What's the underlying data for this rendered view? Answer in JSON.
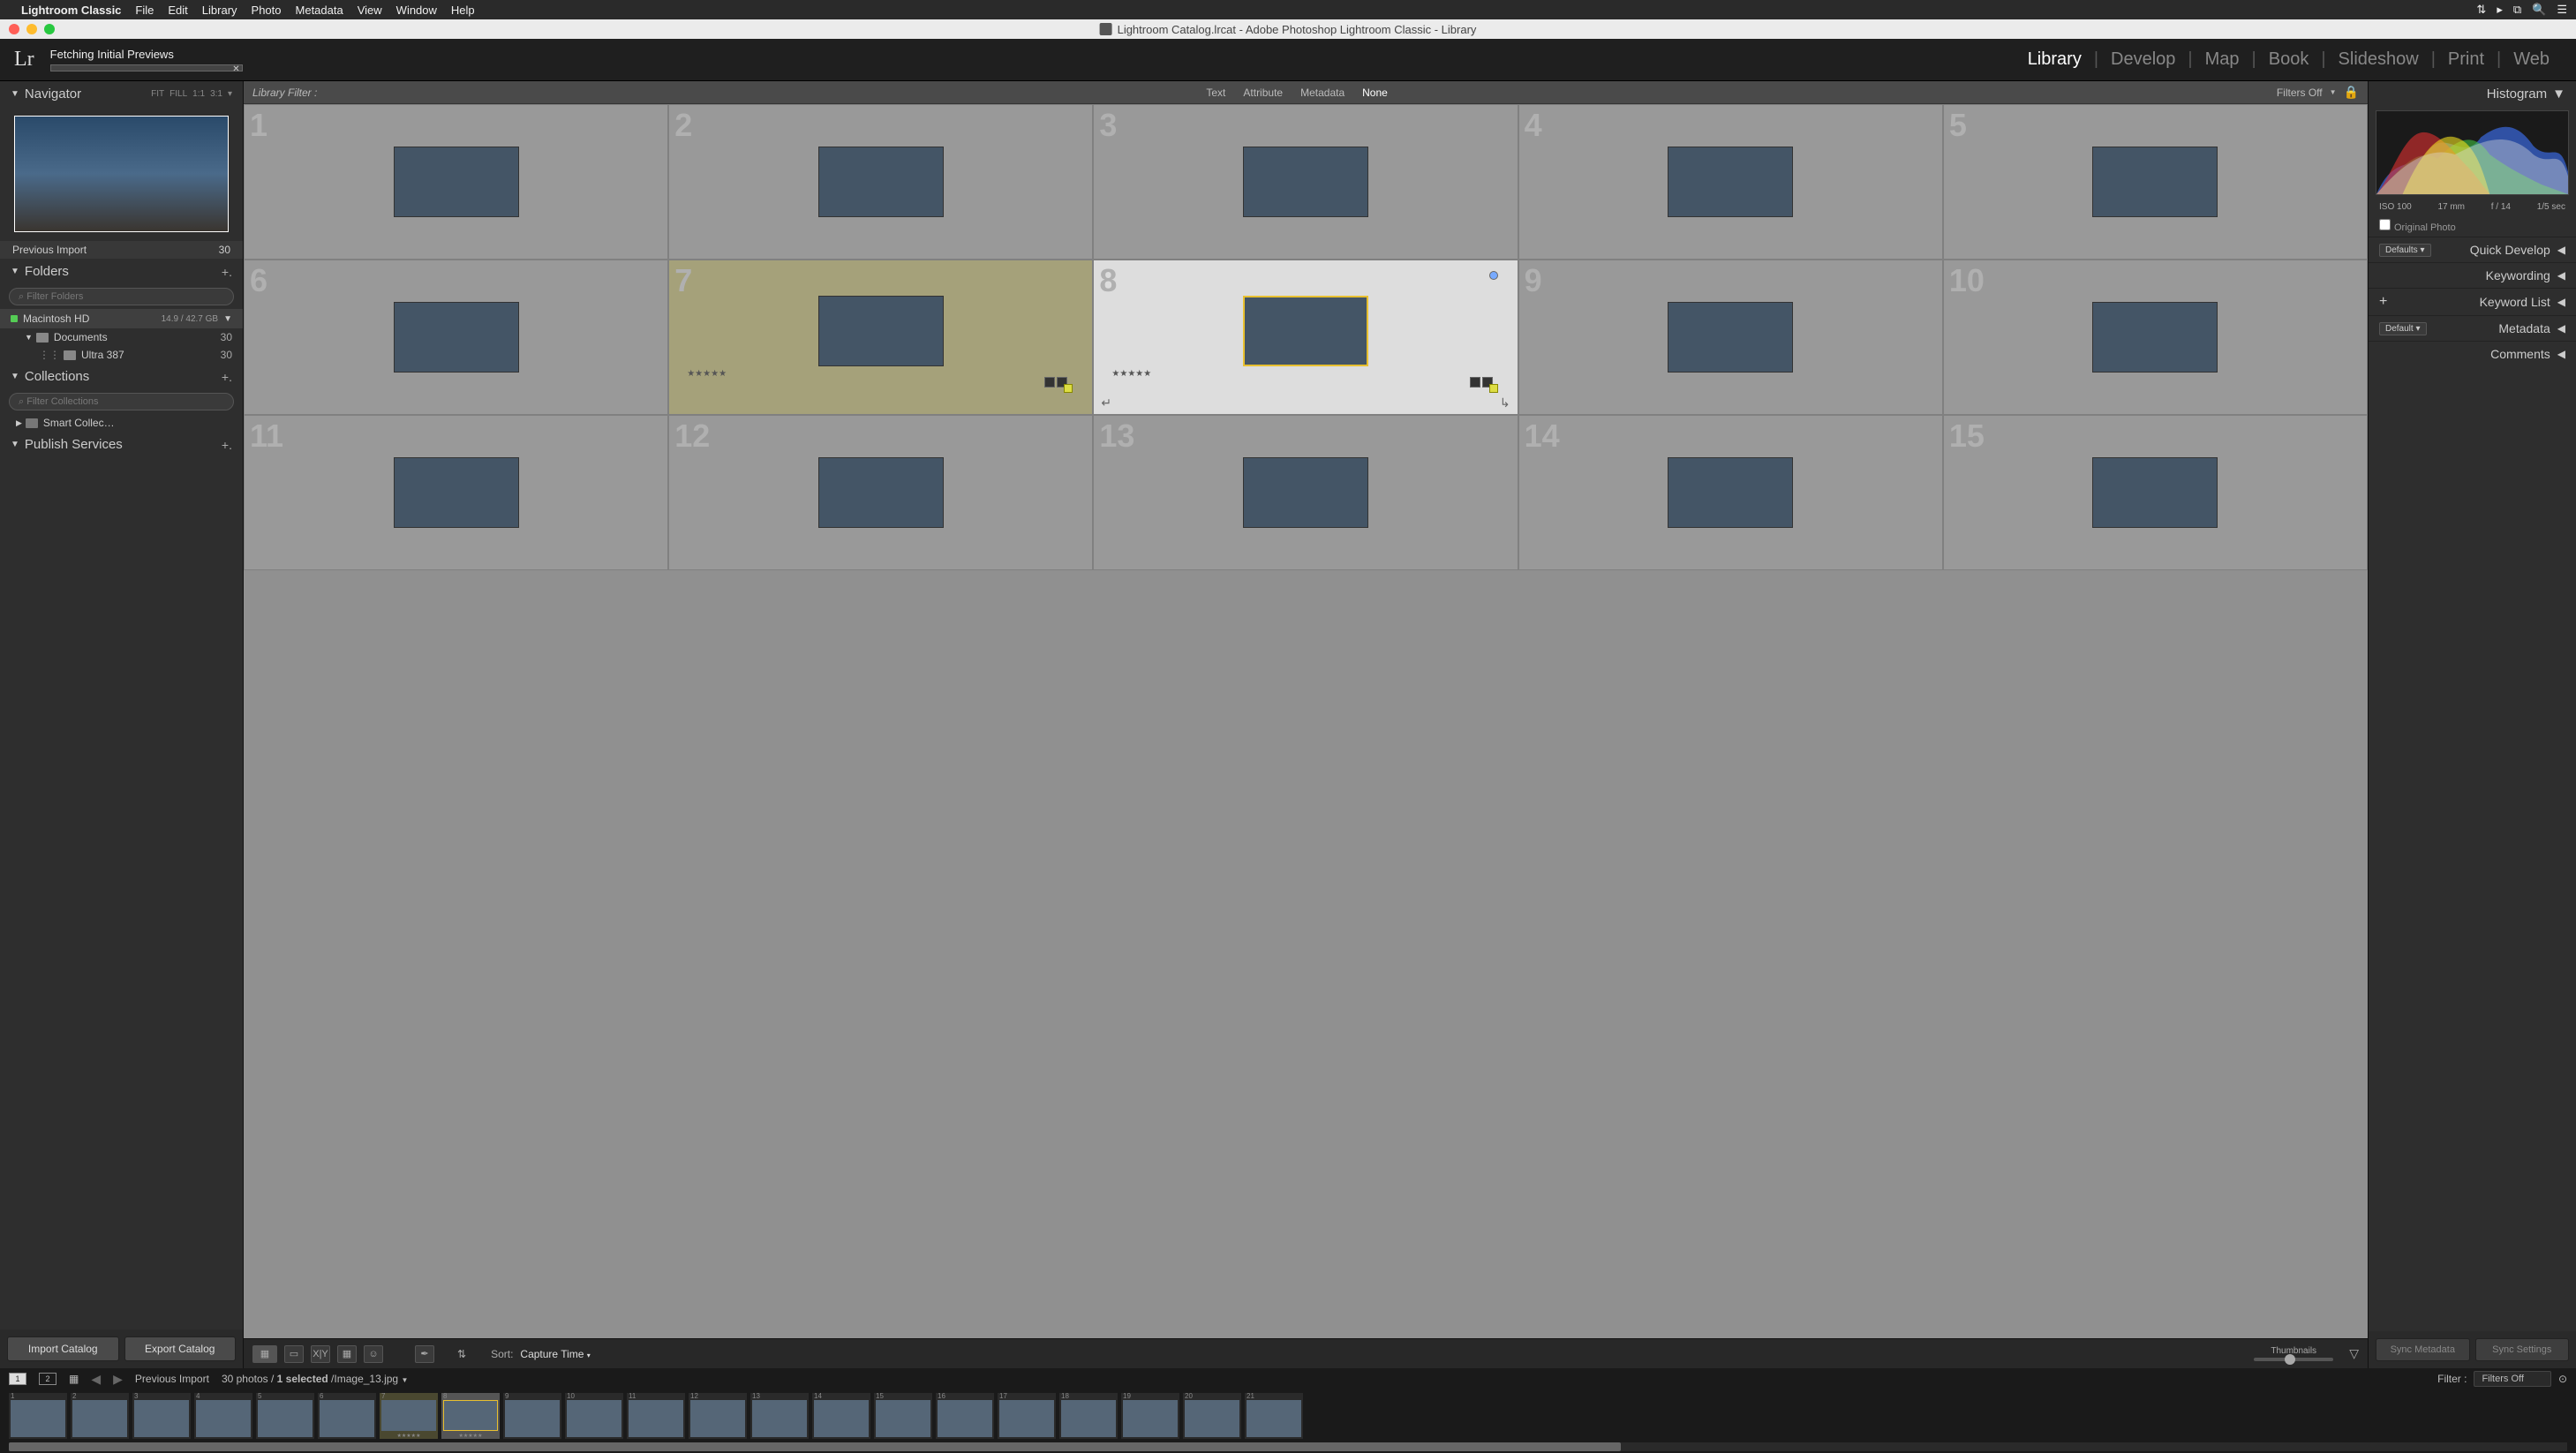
{
  "mac": {
    "app": "Lightroom Classic",
    "menus": [
      "File",
      "Edit",
      "Library",
      "Photo",
      "Metadata",
      "View",
      "Window",
      "Help"
    ]
  },
  "window": {
    "title": "Lightroom Catalog.lrcat - Adobe Photoshop Lightroom Classic - Library"
  },
  "identity": {
    "logo": "Lr",
    "status": "Fetching Initial Previews",
    "modules": [
      "Library",
      "Develop",
      "Map",
      "Book",
      "Slideshow",
      "Print",
      "Web"
    ],
    "active_module": "Library"
  },
  "left": {
    "navigator": {
      "title": "Navigator",
      "modes": [
        "FIT",
        "FILL",
        "1:1",
        "3:1"
      ]
    },
    "previous_import": {
      "label": "Previous Import",
      "count": "30"
    },
    "folders": {
      "title": "Folders",
      "filter_placeholder": "Filter Folders",
      "drive": {
        "name": "Macintosh HD",
        "size": "14.9 / 42.7 GB"
      },
      "items": [
        {
          "name": "Documents",
          "count": "30"
        },
        {
          "name": "Ultra 387",
          "count": "30"
        }
      ]
    },
    "collections": {
      "title": "Collections",
      "filter_placeholder": "Filter Collections",
      "smart": "Smart Collec…"
    },
    "publish": {
      "title": "Publish Services"
    },
    "import_btn": "Import Catalog",
    "export_btn": "Export Catalog"
  },
  "filter_bar": {
    "label": "Library Filter :",
    "options": [
      "Text",
      "Attribute",
      "Metadata",
      "None"
    ],
    "active": "None",
    "filters_off": "Filters Off"
  },
  "grid": {
    "cells": [
      {
        "n": "1",
        "g": "g-snow"
      },
      {
        "n": "2",
        "g": "g-tree"
      },
      {
        "n": "3",
        "g": "g-tree"
      },
      {
        "n": "4",
        "g": "g-falls"
      },
      {
        "n": "5",
        "g": "g-canyon"
      },
      {
        "n": "6",
        "g": "g-canyon"
      },
      {
        "n": "7",
        "g": "g-storm",
        "picked": true,
        "stars": "★★★★★"
      },
      {
        "n": "8",
        "g": "g-storm",
        "selected": true,
        "stars": "★★★★★"
      },
      {
        "n": "9",
        "g": "g-lake"
      },
      {
        "n": "10",
        "g": "g-lake"
      },
      {
        "n": "11",
        "g": "g-bryce"
      },
      {
        "n": "12",
        "g": "g-bryce"
      },
      {
        "n": "13",
        "g": "g-hills"
      },
      {
        "n": "14",
        "g": "g-dome"
      },
      {
        "n": "15",
        "g": "g-dome"
      }
    ]
  },
  "toolbar": {
    "sort_label": "Sort:",
    "sort_value": "Capture Time",
    "thumbnails": "Thumbnails"
  },
  "right": {
    "histogram": {
      "title": "Histogram",
      "iso": "ISO 100",
      "mm": "17 mm",
      "f": "f / 14",
      "shutter": "1/5 sec",
      "original": "Original Photo"
    },
    "quick_develop": {
      "dd": "Defaults",
      "label": "Quick Develop"
    },
    "keywording": "Keywording",
    "keyword_list": "Keyword List",
    "metadata": {
      "dd": "Default",
      "label": "Metadata"
    },
    "comments": "Comments",
    "sync_meta": "Sync Metadata",
    "sync_settings": "Sync Settings"
  },
  "filmstrip": {
    "source": "Previous Import",
    "count": "30 photos /",
    "selected": "1 selected",
    "file": " /Image_13.jpg",
    "filter_label": "Filter :",
    "filter_value": "Filters Off",
    "thumbs": [
      {
        "n": "1",
        "g": "g-snow"
      },
      {
        "n": "2",
        "g": "g-tree"
      },
      {
        "n": "3",
        "g": "g-tree"
      },
      {
        "n": "4",
        "g": "g-falls"
      },
      {
        "n": "5",
        "g": "g-canyon"
      },
      {
        "n": "6",
        "g": "g-canyon"
      },
      {
        "n": "7",
        "g": "g-storm",
        "picked": true,
        "stars": "★★★★★"
      },
      {
        "n": "8",
        "g": "g-storm",
        "selected": true,
        "stars": "★★★★★"
      },
      {
        "n": "9",
        "g": "g-lake"
      },
      {
        "n": "10",
        "g": "g-lake"
      },
      {
        "n": "11",
        "g": "g-bryce"
      },
      {
        "n": "12",
        "g": "g-bryce"
      },
      {
        "n": "13",
        "g": "g-hills"
      },
      {
        "n": "14",
        "g": "g-dome"
      },
      {
        "n": "15",
        "g": "g-dome"
      },
      {
        "n": "16",
        "g": "g-water"
      },
      {
        "n": "17",
        "g": "g-water"
      },
      {
        "n": "18",
        "g": "g-water"
      },
      {
        "n": "19",
        "g": "g-water"
      },
      {
        "n": "20",
        "g": "g-food"
      },
      {
        "n": "21",
        "g": "g-food"
      }
    ]
  }
}
